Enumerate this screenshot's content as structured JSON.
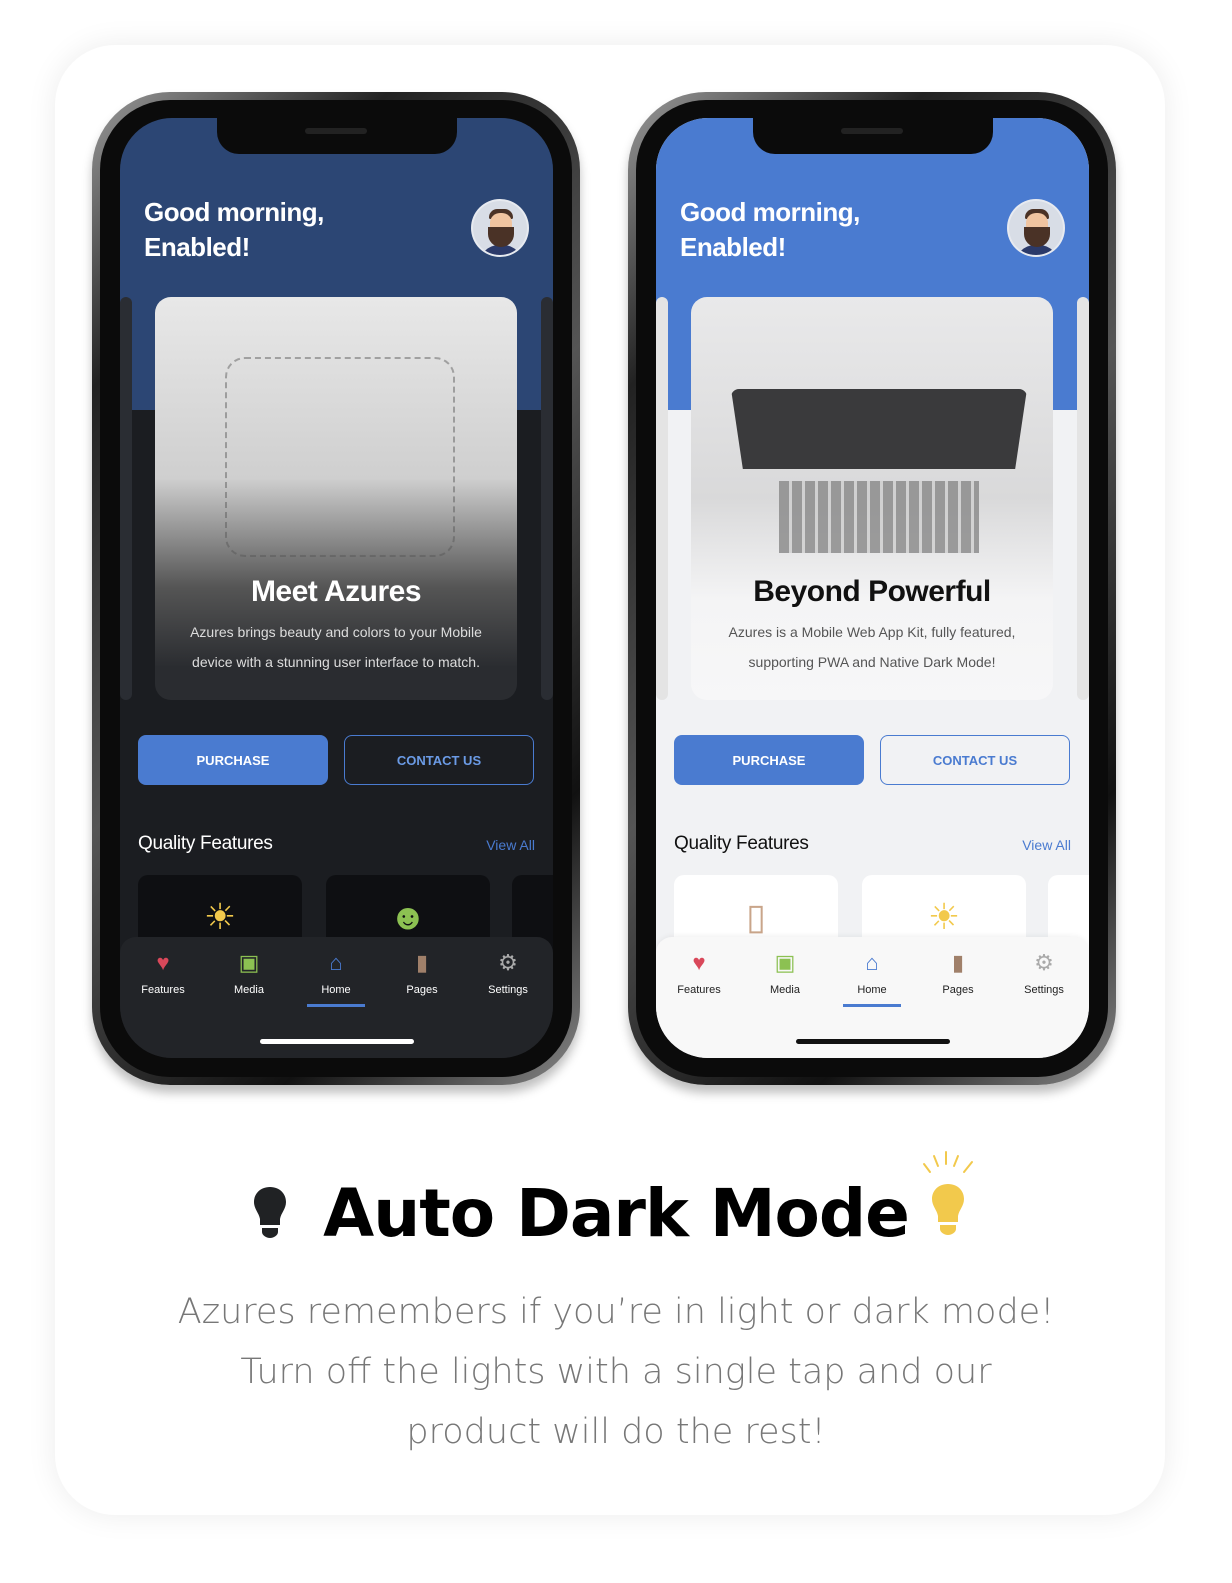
{
  "phones": {
    "dark": {
      "greeting_line1": "Good morning,",
      "greeting_line2": "Enabled!",
      "card_title": "Meet Azures",
      "card_desc": "Azures brings beauty and colors to your Mobile device with a stunning user interface to match.",
      "purchase": "PURCHASE",
      "contact": "CONTACT US",
      "section_title": "Quality Features",
      "view_all": "View All",
      "feature_icons": [
        "sun-icon",
        "smile-icon"
      ]
    },
    "light": {
      "greeting_line1": "Good morning,",
      "greeting_line2": "Enabled!",
      "card_title": "Beyond Powerful",
      "card_desc": "Azures is a Mobile Web App Kit, fully featured, supporting PWA and Native Dark Mode!",
      "purchase": "PURCHASE",
      "contact": "CONTACT US",
      "section_title": "Quality Features",
      "view_all": "View All",
      "feature_icons": [
        "phone-icon",
        "sun-icon"
      ]
    }
  },
  "tabs": [
    {
      "label": "Features",
      "icon": "heart-icon",
      "color": "#d9485a"
    },
    {
      "label": "Media",
      "icon": "image-icon",
      "color": "#8cc152"
    },
    {
      "label": "Home",
      "icon": "home-icon",
      "color": "#4a7bd0",
      "active": true
    },
    {
      "label": "Pages",
      "icon": "file-icon",
      "color": "#a0806a"
    },
    {
      "label": "Settings",
      "icon": "gear-icon",
      "color": "#aaaaaa"
    }
  ],
  "headline": "Auto Dark Mode",
  "description_lines": [
    "Azures remembers if you’re in light or dark mode!",
    "Turn off the lights with a single tap and our",
    "product will do the rest!"
  ],
  "colors": {
    "accent": "#4a7bd0",
    "dark_bg": "#1b1d21",
    "bulb_on": "#f2c94c"
  }
}
